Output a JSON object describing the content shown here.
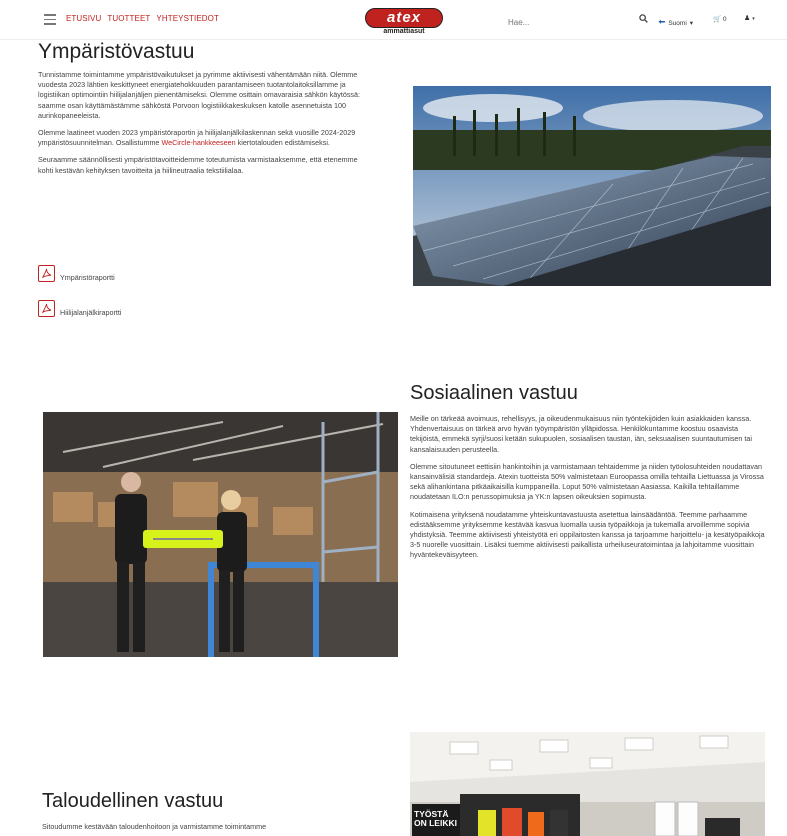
{
  "header": {
    "nav": [
      "ETUSIVU",
      "TUOTTEET",
      "YHTEYSTIEDOT"
    ],
    "logo_text": "atex",
    "logo_sub": "ammattiasut",
    "search_placeholder": "Hae...",
    "language": "Suomi",
    "cart_count": "0"
  },
  "environment": {
    "title": "Ympäristövastuu",
    "p1": "Tunnistamme toimintamme ympäristövaikutukset ja pyrimme aktiivisesti vähentämään niitä. Olemme vuodesta 2023 lähtien keskittyneet energiatehokkuuden parantamiseen tuotantolaitoksillamme ja logistiikan optimointiin hiilijalanjäljen pienentämiseksi. Olemme osittain omavaraisia sähkön käytössä: saamme osan käyttämästämme sähköstä Porvoon logistiikkakeskuksen katolle asennetuista 100 aurinkopaneeleista.",
    "p2_before": "Olemme laatineet vuoden 2023 ympäristöraportin ja  hiilijalanjälkilaskennan sekä vuosille 2024-2029 ympäristösuunnitelman. Osallistumme ",
    "p2_link": "WeCircle-hankkeeseen",
    "p2_after": " kiertotalouden edistämiseksi.",
    "p3": "Seuraamme säännöllisesti ympäristötavoitteidemme toteutumista varmistaaksemme, että etenemme kohti kestävän kehityksen tavoitteita ja hiilineutraalia tekstiilialaa.",
    "link1": "Ympäristöraportti",
    "link2": "Hiilijalanjälkiraportti"
  },
  "social": {
    "title": "Sosiaalinen vastuu",
    "p1": "Meille on tärkeää avoimuus, rehellisyys, ja oikeudenmukaisuus niin työntekijöiden kuin asiakkaiden kanssa. Yhdenvertaisuus on tärkeä arvo hyvän työympäristön ylläpidossa. Henkilökuntamme koostuu osaavista tekijöistä, emmekä syrji/suosi ketään sukupuolen, sosiaalisen taustan, iän, seksuaalisen suuntautumisen tai kansalaisuuden perusteella.",
    "p2": "Olemme sitoutuneet eettisiin hankintoihin ja varmistamaan tehtaidemme ja niiden työolosuhteiden noudattavan kansainvälisiä standardeja. Atexin tuotteista 50% valmistetaan Euroopassa omilla tehtailla Liettuassa ja Virossa sekä alihankintana pitkäaikaisilla kumppaneilla. Loput 50% valmistetaan Aasiassa. Kaikilla tehtaillamme noudatetaan ILO:n perussopimuksia ja YK:n lapsen oikeuksien sopimusta.",
    "p3": "Kotimaisena yrityksenä noudatamme yhteiskuntavastuusta asetettua lainsäädäntöä. Teemme parhaamme edistääksemme yrityksemme kestävää kasvua luomalla uusia työpaikkoja ja tukemalla arvoillemme sopivia yhdistyksiä. Teemme aktiivisesti yhteistyötä eri oppilaitosten kanssa ja tarjoamme harjoittelu- ja kesätyöpaikkoja 3-5 nuorelle vuosittain. Lisäksi tuemme aktiivisesti paikallista urheiluseuratoimintaa ja lahjoitamme vuosittain hyväntekeväisyyteen."
  },
  "economic": {
    "title": "Taloudellinen vastuu",
    "p1": "Sitoudumme kestävään taloudenhoitoon ja varmistamme toimintamme",
    "banner_text_1": "TYÖSTÄ",
    "banner_text_2": "ON LEIKKI"
  }
}
